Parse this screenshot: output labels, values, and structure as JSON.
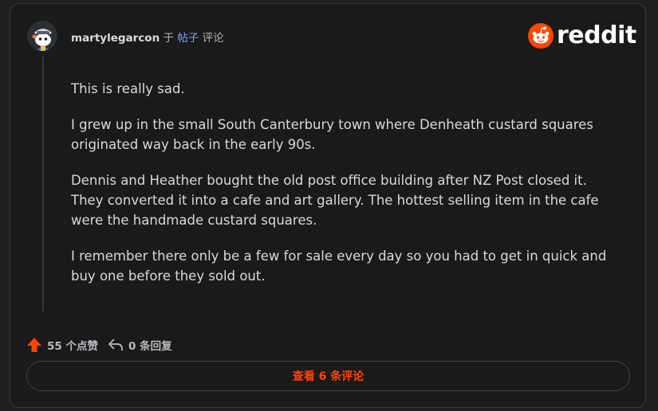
{
  "header": {
    "username": "martylegarcon",
    "connector": " 于 ",
    "post_link": "帖子",
    "action": " 评论"
  },
  "logo": {
    "wordmark": "reddit",
    "brand_color": "#ff4500"
  },
  "comment": {
    "paragraphs": [
      "This is really sad.",
      "I grew up in the small South Canterbury town where Denheath custard squares originated way back in the early 90s.",
      "Dennis and Heather bought the old post office building after NZ Post closed it. They converted it into a cafe and art gallery. The hottest selling item in the cafe were the handmade custard squares.",
      "I remember there only be a few for sale every day so you had to get in quick and buy one before they sold out."
    ]
  },
  "actions": {
    "upvote_icon": "upvote-arrow-icon",
    "upvotes_label": "55 个点赞",
    "reply_icon": "reply-arrow-icon",
    "replies_label": "0 条回复"
  },
  "view_comments": {
    "label": "查看 6 条评论"
  }
}
